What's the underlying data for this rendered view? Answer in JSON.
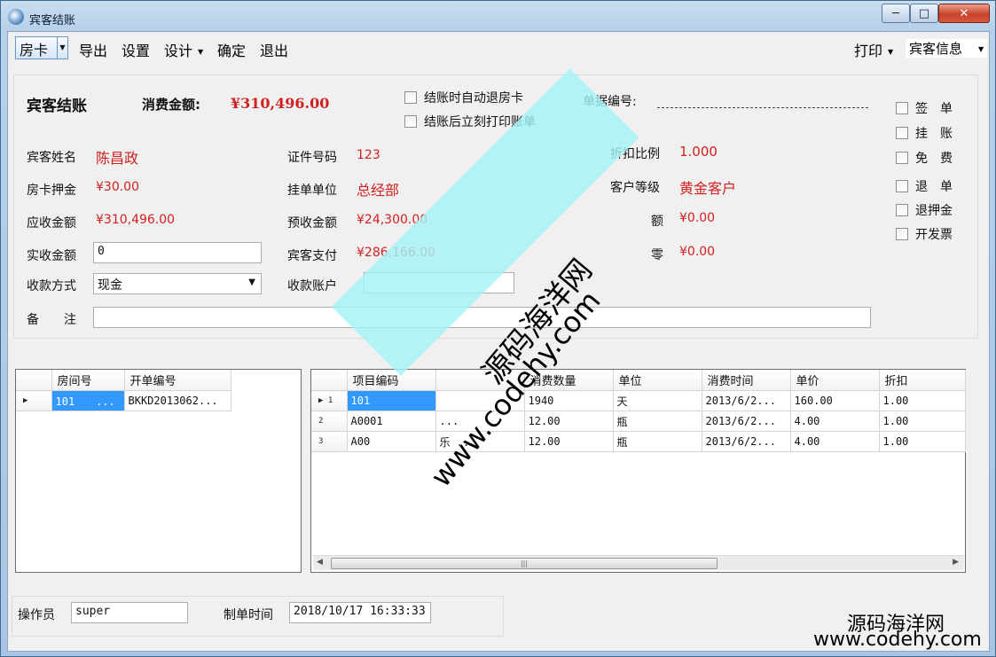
{
  "window": {
    "title": "宾客结账",
    "min": "─",
    "max": "□",
    "close": "✕"
  },
  "menu": {
    "room_card": "房卡",
    "export": "导出",
    "settings": "设置",
    "design": "设计",
    "confirm": "确定",
    "exit": "退出",
    "print": "打印",
    "guest_info": "宾客信息"
  },
  "summary": {
    "heading": "宾客结账",
    "amount_label": "消费金额:",
    "amount_value": "¥310,496.00"
  },
  "options": {
    "auto_return": "结账时自动退房卡",
    "print_after": "结账后立刻打印账单"
  },
  "bill": {
    "label": "单据编号:"
  },
  "fields": {
    "guest_name_label": "宾客姓名",
    "guest_name": "陈昌政",
    "id_label": "证件号码",
    "id_value": "123",
    "discount_label": "折扣比例",
    "discount_value": "1.000",
    "deposit_label": "房卡押金",
    "deposit_value": "¥30.00",
    "unit_label": "挂单单位",
    "unit_value": "总经部",
    "level_label": "客户等级",
    "level_value": "黄金客户",
    "receivable_label": "应收金额",
    "receivable_value": "¥310,496.00",
    "prepaid_label": "预收金额",
    "prepaid_value": "¥24,300.00",
    "hidden1_label": "额",
    "hidden1_value": "¥0.00",
    "actual_label": "实收金额",
    "actual_value": "0",
    "guestpay_label": "宾客支付",
    "guestpay_value": "¥286,166.00",
    "hidden2_label": "零",
    "hidden2_value": "¥0.00",
    "method_label": "收款方式",
    "method_value": "现金",
    "account_label": "收款账户",
    "account_value": "",
    "remark_label": "备　　注",
    "remark_value": ""
  },
  "checkboxes": [
    "签　单",
    "挂　账",
    "免　费",
    "退　单",
    "退押金",
    "开发票"
  ],
  "room_grid": {
    "columns": [
      "房间号",
      "开单编号"
    ],
    "rows": [
      [
        "101　　...",
        "BKKD2013062..."
      ]
    ]
  },
  "item_grid": {
    "columns": [
      "项目编码",
      "",
      "消费数量",
      "单位",
      "消费时间",
      "单价",
      "折扣"
    ],
    "rows": [
      [
        "1",
        "101",
        "",
        "1940",
        "天",
        "2013/6/2...",
        "160.00",
        "1.00"
      ],
      [
        "2",
        "A0001",
        "...",
        "12.00",
        "瓶",
        "2013/6/2...",
        "4.00",
        "1.00"
      ],
      [
        "3",
        "A00",
        "乐 ...",
        "12.00",
        "瓶",
        "2013/6/2...",
        "4.00",
        "1.00"
      ]
    ]
  },
  "footer": {
    "operator_label": "操作员",
    "operator_value": "super",
    "time_label": "制单时间",
    "time_value": "2018/10/17 16:33:33"
  },
  "watermark": {
    "cn": "源码海洋网",
    "url": "www.codehy.com"
  },
  "brand": {
    "cn": "源码海洋网",
    "url": "www.codehy.com"
  }
}
